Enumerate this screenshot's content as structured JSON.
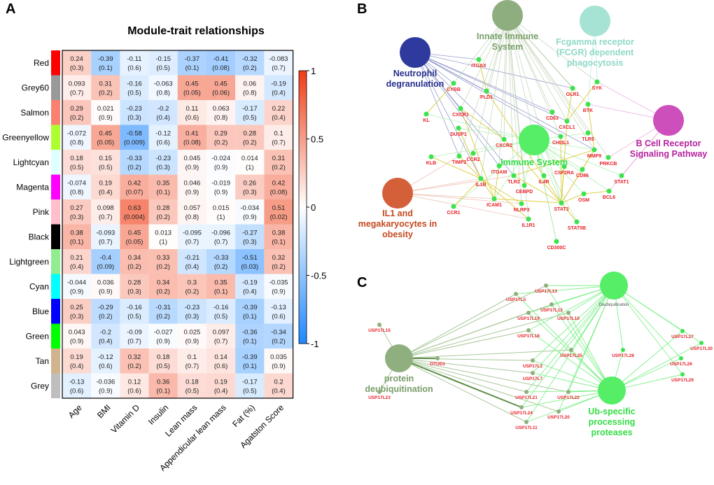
{
  "panels": {
    "a": "A",
    "b": "B",
    "c": "C"
  },
  "chart_data": [
    {
      "type": "heatmap",
      "title": "Module-trait relationships",
      "rows": [
        "Red",
        "Grey60",
        "Salmon",
        "Greenyellow",
        "Lightcyan",
        "Magenta",
        "Pink",
        "Black",
        "Lightgreen",
        "Cyan",
        "Blue",
        "Green",
        "Tan",
        "Grey"
      ],
      "row_colors": [
        "#ff0000",
        "#999999",
        "#fa8072",
        "#adff2f",
        "#e0ffff",
        "#ff00ff",
        "#ffc0cb",
        "#000000",
        "#90ee90",
        "#00ffff",
        "#0000ff",
        "#00ff00",
        "#d2b48c",
        "#bebebe"
      ],
      "columns": [
        "Age",
        "BMI",
        "Vitamin D",
        "Insulin",
        "Lean mass",
        "Appendicular lean mass",
        "Fat (%)",
        "Agatston Score"
      ],
      "values": [
        [
          0.24,
          -0.39,
          -0.11,
          -0.15,
          -0.37,
          -0.41,
          -0.32,
          -0.083
        ],
        [
          0.093,
          0.31,
          -0.16,
          -0.063,
          0.45,
          0.45,
          0.06,
          -0.19
        ],
        [
          0.29,
          0.021,
          -0.23,
          -0.2,
          0.11,
          0.063,
          -0.17,
          0.22
        ],
        [
          -0.072,
          0.45,
          -0.58,
          -0.12,
          0.41,
          0.29,
          0.28,
          0.1
        ],
        [
          0.18,
          0.15,
          -0.33,
          -0.23,
          0.045,
          -0.024,
          0.014,
          0.31
        ],
        [
          -0.074,
          0.19,
          0.42,
          0.35,
          0.046,
          -0.019,
          0.26,
          0.42
        ],
        [
          0.27,
          0.098,
          0.63,
          0.28,
          0.057,
          0.015,
          -0.034,
          0.51
        ],
        [
          0.38,
          -0.093,
          0.45,
          0.013,
          -0.095,
          -0.096,
          -0.27,
          0.38
        ],
        [
          0.21,
          -0.4,
          0.34,
          0.33,
          -0.21,
          -0.33,
          -0.51,
          0.32
        ],
        [
          -0.044,
          0.036,
          0.28,
          0.34,
          0.3,
          0.35,
          -0.19,
          -0.035
        ],
        [
          0.25,
          -0.29,
          -0.16,
          -0.31,
          -0.23,
          -0.16,
          -0.39,
          -0.13
        ],
        [
          0.043,
          -0.2,
          -0.09,
          -0.027,
          0.025,
          0.097,
          -0.36,
          -0.34
        ],
        [
          0.19,
          -0.12,
          0.32,
          0.18,
          0.1,
          0.14,
          -0.39,
          0.035
        ],
        [
          -0.13,
          -0.036,
          0.12,
          0.36,
          0.18,
          0.19,
          -0.17,
          0.2
        ]
      ],
      "pvalues": [
        [
          "0.3",
          "0.1",
          "0.6",
          "0.5",
          "0.1",
          "0.08",
          "0.2",
          "0.7"
        ],
        [
          "0.7",
          "0.2",
          "0.5",
          "0.8",
          "0.05",
          "0.06",
          "0.8",
          "0.4"
        ],
        [
          "0.2",
          "0.9",
          "0.3",
          "0.4",
          "0.6",
          "0.8",
          "0.5",
          "0.4"
        ],
        [
          "0.8",
          "0.05",
          "0.009",
          "0.6",
          "0.08",
          "0.2",
          "0.2",
          "0.7"
        ],
        [
          "0.5",
          "0.5",
          "0.2",
          "0.3",
          "0.9",
          "0.9",
          "1",
          "0.2"
        ],
        [
          "0.8",
          "0.4",
          "0.07",
          "0.1",
          "0.9",
          "0.9",
          "0.3",
          "0.08"
        ],
        [
          "0.3",
          "0.7",
          "0.004",
          "0.2",
          "0.8",
          "1",
          "0.9",
          "0.02"
        ],
        [
          "0.1",
          "0.7",
          "0.05",
          "1",
          "0.7",
          "0.7",
          "0.3",
          "0.1"
        ],
        [
          "0.4",
          "0.09",
          "0.2",
          "0.2",
          "0.4",
          "0.2",
          "0.03",
          "0.2"
        ],
        [
          "0.9",
          "0.9",
          "0.3",
          "0.2",
          "0.2",
          "0.1",
          "0.4",
          "0.9"
        ],
        [
          "0.3",
          "0.2",
          "0.5",
          "0.2",
          "0.3",
          "0.5",
          "0.1",
          "0.6"
        ],
        [
          "0.9",
          "0.4",
          "0.7",
          "0.9",
          "0.9",
          "0.7",
          "0.1",
          "0.2"
        ],
        [
          "0.4",
          "0.6",
          "0.2",
          "0.5",
          "0.7",
          "0.6",
          "0.1",
          "0.9"
        ],
        [
          "0.6",
          "0.9",
          "0.6",
          "0.1",
          "0.5",
          "0.4",
          "0.5",
          "0.4"
        ]
      ],
      "colorbar": {
        "range": [
          -1,
          1
        ],
        "ticks": [
          "1",
          "0.5",
          "0",
          "-0.5",
          "-1"
        ],
        "low_color": "#1e88ff",
        "mid_color": "#ffffff",
        "high_color": "#f03c14"
      }
    }
  ],
  "network_b": {
    "hubs": [
      {
        "id": "innate",
        "label": [
          "Innate Immune",
          "System"
        ],
        "color": "#8fae80",
        "label_color": "#7aa06a"
      },
      {
        "id": "fcgr",
        "label": [
          "Fcgamma receptor",
          "(FCGR) dependent",
          "phagocytosis"
        ],
        "color": "#a6e3d4",
        "label_color": "#8fd9c6"
      },
      {
        "id": "neutro",
        "label": [
          "Neutrophil",
          "degranulation"
        ],
        "color": "#2e3a9e",
        "label_color": "#26308c"
      },
      {
        "id": "immune",
        "label": [
          "Immune System"
        ],
        "color": "#55ee66",
        "label_color": "#33dd44"
      },
      {
        "id": "bcell",
        "label": [
          "B Cell Receptor",
          "Signaling Pathway"
        ],
        "color": "#cc4fbb",
        "label_color": "#b5249f"
      },
      {
        "id": "il1",
        "label": [
          "IL1 and",
          "megakaryocytes in",
          "obesity"
        ],
        "color": "#d4603a",
        "label_color": "#c44a20"
      }
    ],
    "genes": [
      "ITGAX",
      "CYBB",
      "PLD1",
      "CXCR1",
      "KL",
      "DUSP1",
      "CXCR2",
      "CD63",
      "CXCL1",
      "CHI3L1",
      "OLR1",
      "SYK",
      "BTK",
      "TLR5",
      "MMP9",
      "PRKCB",
      "KLB",
      "TIMP2",
      "CCR2",
      "ITGAM",
      "TLR2",
      "IL1B",
      "IL4R",
      "CSF2RA",
      "CD86",
      "STAT1",
      "CEBPD",
      "ICAM1",
      "NLRP3",
      "STAT3",
      "OSM",
      "BCL6",
      "CCR1",
      "IL1R1",
      "STAT5B",
      "CD300C"
    ]
  },
  "network_c": {
    "hubs": [
      {
        "id": "deubiq",
        "label": [
          "protein",
          "deubiquitination"
        ],
        "color": "#8fb07e",
        "label_color": "#7a9c68"
      },
      {
        "id": "deubiq2",
        "label": [
          "Deubiquitination"
        ],
        "color": "#55ee66",
        "label_color": "#555555"
      },
      {
        "id": "ubsp",
        "label": [
          "Ub-specific",
          "processing",
          "proteases"
        ],
        "color": "#55ee66",
        "label_color": "#33dd44"
      }
    ],
    "genes": [
      "USP17L15",
      "USP17L23",
      "OTUD1",
      "USP17L5",
      "USP17L13",
      "USP17L12",
      "USP17L19",
      "USP17L10",
      "USP17L18",
      "USP17L25",
      "USP17L2",
      "USP17L7",
      "USP17L21",
      "USP17L22",
      "USP17L24",
      "USP17L20",
      "USP17L11",
      "USP17L28",
      "USP17L27",
      "USP17L30",
      "USP17L26",
      "USP17L29"
    ]
  }
}
